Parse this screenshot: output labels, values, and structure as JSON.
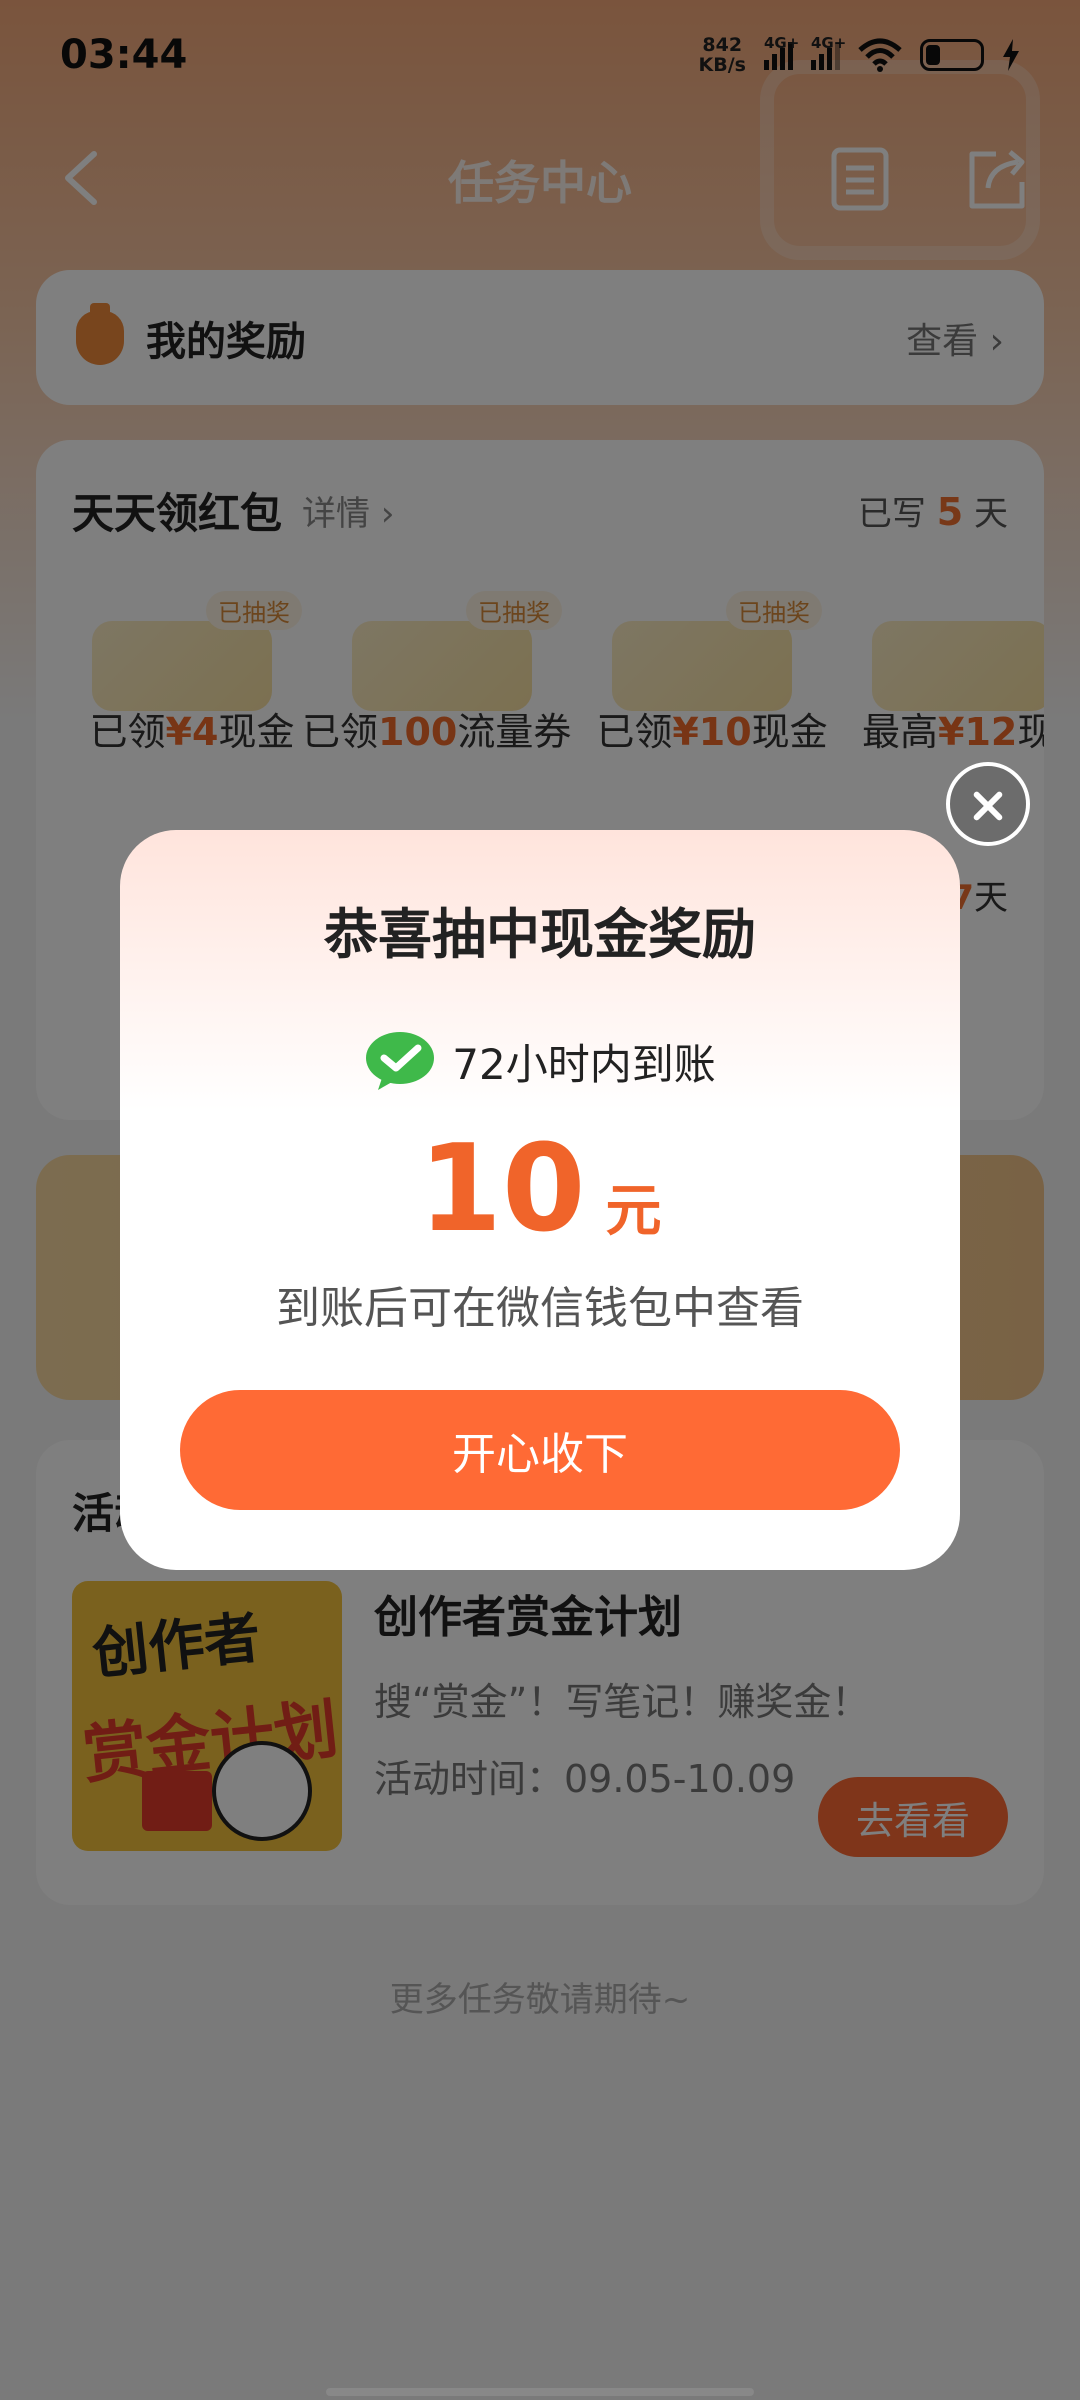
{
  "status_bar": {
    "time": "03:44",
    "net_speed": "842",
    "net_unit": "KB/s",
    "signal1": "4G+",
    "signal2": "4G+"
  },
  "nav": {
    "title": "任务中心"
  },
  "reward_row": {
    "label": "我的奖励",
    "action": "查看"
  },
  "daily": {
    "title": "天天领红包",
    "detail_link": "详情",
    "written_prefix": "已写",
    "written_days": "5",
    "written_suffix": "天",
    "prizes": [
      {
        "badge": "已抽奖",
        "prefix": "已领",
        "amount": "¥4",
        "suffix": "现金"
      },
      {
        "badge": "已抽奖",
        "prefix": "已领",
        "amount": "100",
        "suffix": "流量券"
      },
      {
        "badge": "已抽奖",
        "prefix": "已领",
        "amount": "¥10",
        "suffix": "现金"
      },
      {
        "badge": "",
        "prefix": "最高",
        "amount": "¥12",
        "suffix": "现金"
      }
    ],
    "day7_day": "7",
    "day7_suffix": "天"
  },
  "activity": {
    "header": "活动",
    "image_line1": "创作者",
    "image_line2": "赏金计划",
    "name": "创作者赏金计划",
    "desc": "搜“赏金”！写笔记！赚奖金！",
    "time": "活动时间：09.05-10.09",
    "button": "去看看"
  },
  "footer_note": "更多任务敬请期待~",
  "dialog": {
    "title": "恭喜抽中现金奖励",
    "arrival": "72小时内到账",
    "amount": "10",
    "unit": "元",
    "note": "到账后可在微信钱包中查看",
    "button": "开心收下"
  },
  "colors": {
    "accent": "#ff6a35",
    "amount": "#f0642a",
    "wechat_green": "#3fb94a"
  },
  "icons": [
    "back-icon",
    "document-icon",
    "share-icon",
    "money-bag-icon",
    "chevron-right-icon",
    "wechat-icon",
    "close-icon"
  ]
}
